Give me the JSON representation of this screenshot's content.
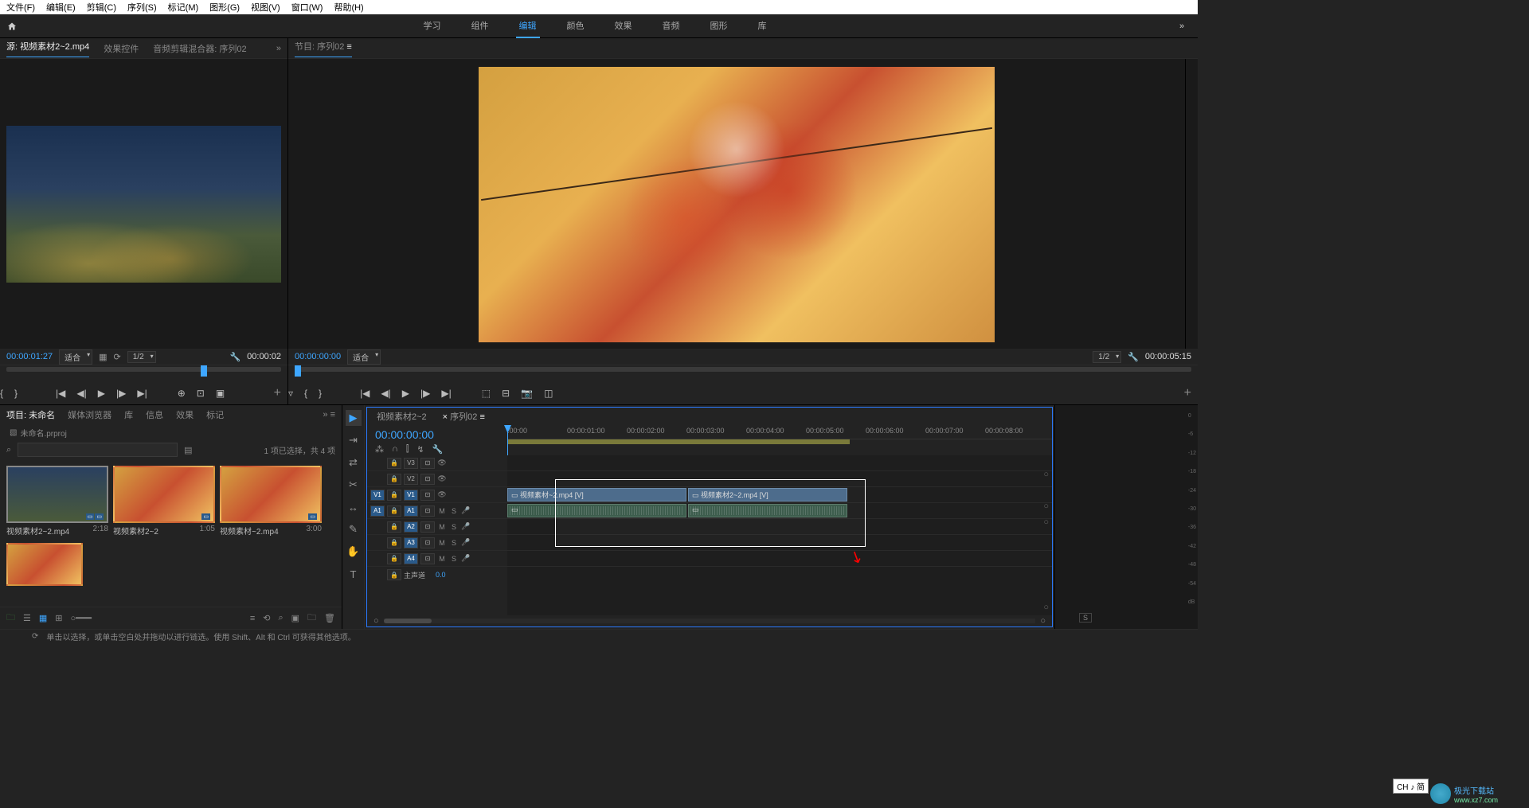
{
  "menu": [
    "文件(F)",
    "编辑(E)",
    "剪辑(C)",
    "序列(S)",
    "标记(M)",
    "图形(G)",
    "视图(V)",
    "窗口(W)",
    "帮助(H)"
  ],
  "workspaces": {
    "items": [
      "学习",
      "组件",
      "编辑",
      "颜色",
      "效果",
      "音频",
      "图形",
      "库"
    ],
    "active": "编辑"
  },
  "source_panel": {
    "tabs": {
      "source": "源: 视频素材2~2.mp4",
      "effect_controls": "效果控件",
      "audio_mixer": "音频剪辑混合器: 序列02"
    },
    "tc_in": "00:00:01:27",
    "fit": "适合",
    "zoom": "1/2",
    "tc_out": "00:00:02"
  },
  "program_panel": {
    "title": "节目: 序列02",
    "tc_in": "00:00:00:00",
    "fit": "适合",
    "zoom": "1/2",
    "tc_out": "00:00:05:15"
  },
  "project_panel": {
    "tabs": [
      "项目: 未命名",
      "媒体浏览器",
      "库",
      "信息",
      "效果",
      "标记"
    ],
    "path": "未命名.prproj",
    "selection_info": "1 项已选择，共 4 项",
    "items": [
      {
        "name": "视频素材2~2.mp4",
        "dur": "2:18",
        "type": "city",
        "selected": true,
        "badged": true
      },
      {
        "name": "视频素材2~2",
        "dur": "1:05",
        "type": "leaves",
        "badged": true
      },
      {
        "name": "视频素材~2.mp4",
        "dur": "3:00",
        "type": "leaves",
        "badged": true
      },
      {
        "name": "",
        "dur": "",
        "type": "leaves"
      }
    ]
  },
  "timeline": {
    "tabs": {
      "t1": "视频素材2~2",
      "t2": "序列02"
    },
    "tc": "00:00:00:00",
    "ticks": [
      ":00:00",
      "00:00:01:00",
      "00:00:02:00",
      "00:00:03:00",
      "00:00:04:00",
      "00:00:05:00",
      "00:00:06:00",
      "00:00:07:00",
      "00:00:08:00"
    ],
    "video_tracks": [
      "V3",
      "V2",
      "V1"
    ],
    "audio_tracks": [
      "A1",
      "A2",
      "A3",
      "A4"
    ],
    "src_v": "V1",
    "src_a": "A1",
    "master": "主声道",
    "master_val": "0.0",
    "clips": {
      "v1a": "视频素材~2.mp4 [V]",
      "v1b": "视频素材2~2.mp4 [V]"
    }
  },
  "status": "单击以选择，或单击空白处并拖动以进行链选。使用 Shift、Alt 和 Ctrl 可获得其他选项。",
  "ime": "CH ♪ 简",
  "watermark": {
    "cn": "极光下载站",
    "url": "www.xz7.com"
  },
  "audio_scale": [
    "0",
    "-6",
    "-12",
    "-18",
    "-24",
    "-30",
    "-36",
    "-42",
    "-48",
    "-54",
    "dB"
  ],
  "solo_label": "S"
}
